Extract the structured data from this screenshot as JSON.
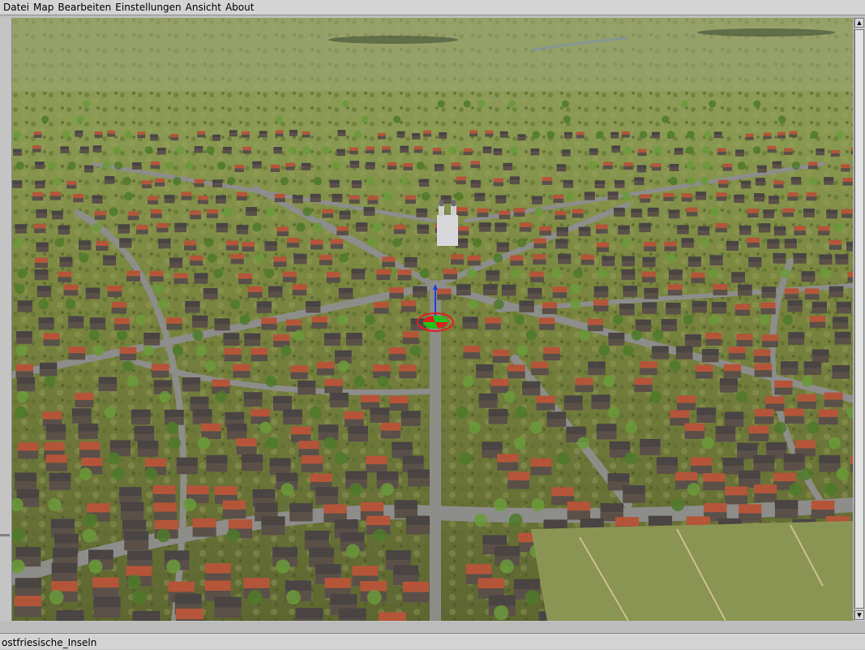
{
  "menubar": {
    "items": [
      "Datei",
      "Map",
      "Bearbeiten",
      "Einstellungen",
      "Ansicht",
      "About"
    ]
  },
  "statusbar": {
    "map_name": "ostfriesische_Inseln"
  },
  "colors": {
    "chrome": "#d4d4d4",
    "grass": "#7f8a45",
    "road": "#8d8d8a",
    "roof_red": "#b4553a",
    "roof_dark": "#4a4443",
    "gizmo_red": "#e02020",
    "gizmo_green": "#18c818",
    "gizmo_blue": "#2040e0"
  }
}
